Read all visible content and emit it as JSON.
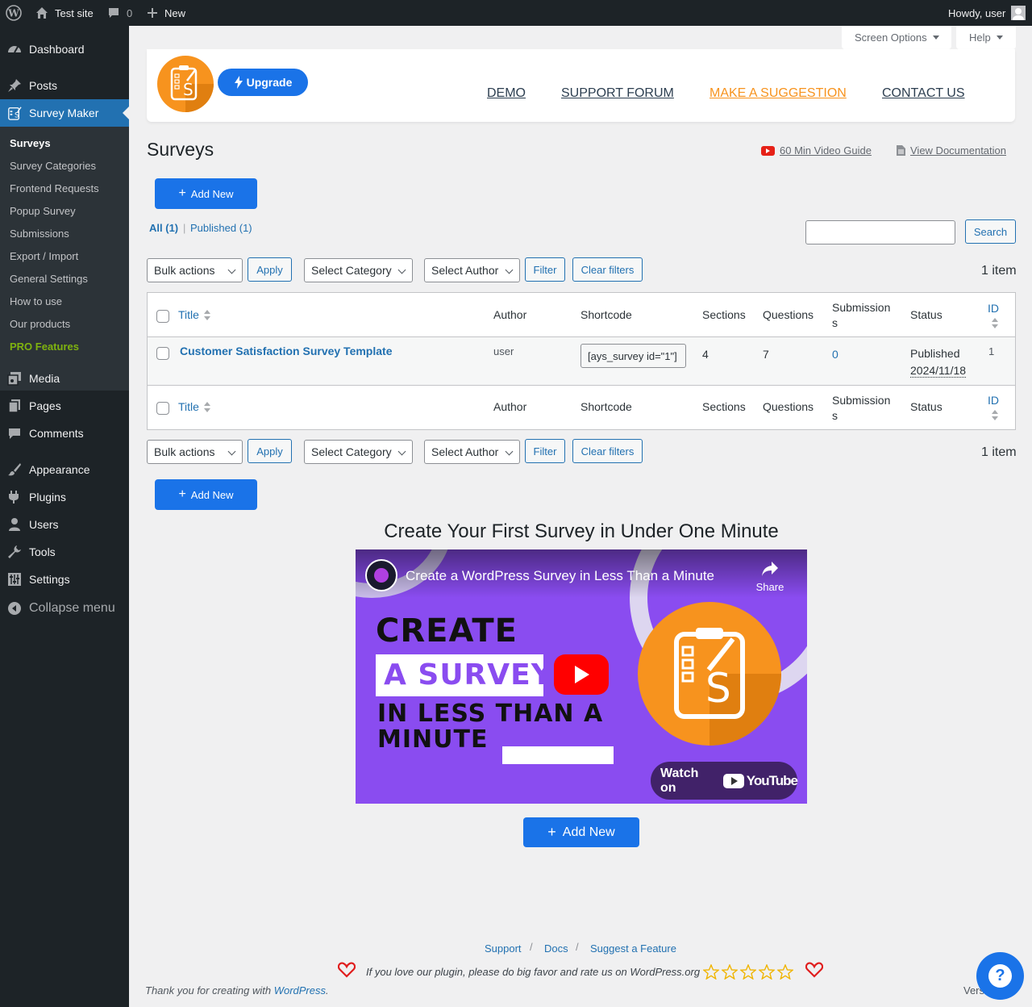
{
  "adminbar": {
    "site": "Test site",
    "comments": "0",
    "new": "New",
    "howdy": "Howdy, user"
  },
  "sidebar": {
    "items": [
      {
        "label": "Dashboard",
        "icon": "dashboard-icon"
      },
      {
        "label": "Posts",
        "icon": "pin-icon"
      },
      {
        "label": "Survey Maker",
        "icon": "survey-maker-icon"
      },
      {
        "label": "Media",
        "icon": "media-icon"
      },
      {
        "label": "Pages",
        "icon": "pages-icon"
      },
      {
        "label": "Comments",
        "icon": "comment-icon"
      },
      {
        "label": "Appearance",
        "icon": "brush-icon"
      },
      {
        "label": "Plugins",
        "icon": "plugin-icon"
      },
      {
        "label": "Users",
        "icon": "user-icon"
      },
      {
        "label": "Tools",
        "icon": "wrench-icon"
      },
      {
        "label": "Settings",
        "icon": "settings-icon"
      },
      {
        "label": "Collapse menu",
        "icon": "collapse-icon"
      }
    ],
    "submenu": [
      "Surveys",
      "Survey Categories",
      "Frontend Requests",
      "Popup Survey",
      "Submissions",
      "Export / Import",
      "General Settings",
      "How to use",
      "Our products",
      "PRO Features"
    ]
  },
  "topbar": {
    "screen_options": "Screen Options",
    "help": "Help"
  },
  "brand": {
    "upgrade": "Upgrade",
    "links": [
      "DEMO",
      "SUPPORT FORUM",
      "MAKE A SUGGESTION",
      "CONTACT US"
    ]
  },
  "page": {
    "title": "Surveys",
    "video_guide": "60 Min Video Guide",
    "documentation": "View Documentation",
    "add_new": "Add New"
  },
  "filters": {
    "all": "All",
    "all_count": "(1)",
    "published": "Published",
    "published_count": "(1)",
    "sep": "|",
    "search": "Search",
    "search_value": "",
    "bulk": "Bulk actions",
    "apply": "Apply",
    "category": "Select Category",
    "author": "Select Author",
    "filter": "Filter",
    "clear": "Clear filters",
    "items": "1 item"
  },
  "table": {
    "columns": [
      "Title",
      "Author",
      "Shortcode",
      "Sections",
      "Questions",
      "Submission",
      "s",
      "Status",
      "ID"
    ],
    "rows": [
      {
        "title": "Customer Satisfaction Survey Template",
        "author": "user",
        "shortcode": "[ays_survey id=\"1\"]",
        "sections": "4",
        "questions": "7",
        "submissions": "0",
        "status": "Published",
        "date": "2024/11/18",
        "id": "1"
      }
    ]
  },
  "promo": {
    "heading": "Create Your First Survey in Under One Minute",
    "video_title": "Create a WordPress Survey in Less Than a Minute",
    "share": "Share",
    "line1": "CREATE",
    "line2": "A SURVEY",
    "line3": "IN LESS THAN A",
    "line4": "MINUTE",
    "watch": "Watch on",
    "youtube": "YouTube",
    "add_new": "Add New"
  },
  "footer": {
    "support": "Support",
    "docs": "Docs",
    "suggest": "Suggest a Feature",
    "sep": "/",
    "rate": "If you love our plugin, please do big favor and rate us on WordPress.org",
    "thanks": "Thank you for creating with ",
    "wordpress": "WordPress",
    "period": ".",
    "version": "Vers"
  },
  "colors": {
    "accent": "#2271b1",
    "button": "#1a73e8",
    "orange": "#f7931e",
    "pro": "#7fb30f",
    "video_bg": "#8a4cf0"
  }
}
